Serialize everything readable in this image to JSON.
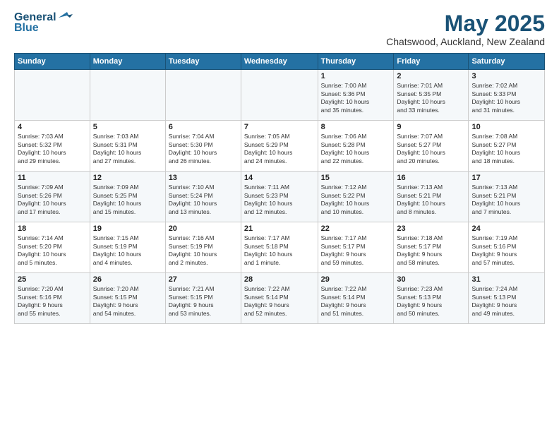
{
  "header": {
    "logo_line1": "General",
    "logo_line2": "Blue",
    "month": "May 2025",
    "location": "Chatswood, Auckland, New Zealand"
  },
  "days_of_week": [
    "Sunday",
    "Monday",
    "Tuesday",
    "Wednesday",
    "Thursday",
    "Friday",
    "Saturday"
  ],
  "weeks": [
    [
      {
        "day": "",
        "info": ""
      },
      {
        "day": "",
        "info": ""
      },
      {
        "day": "",
        "info": ""
      },
      {
        "day": "",
        "info": ""
      },
      {
        "day": "1",
        "info": "Sunrise: 7:00 AM\nSunset: 5:36 PM\nDaylight: 10 hours\nand 35 minutes."
      },
      {
        "day": "2",
        "info": "Sunrise: 7:01 AM\nSunset: 5:35 PM\nDaylight: 10 hours\nand 33 minutes."
      },
      {
        "day": "3",
        "info": "Sunrise: 7:02 AM\nSunset: 5:33 PM\nDaylight: 10 hours\nand 31 minutes."
      }
    ],
    [
      {
        "day": "4",
        "info": "Sunrise: 7:03 AM\nSunset: 5:32 PM\nDaylight: 10 hours\nand 29 minutes."
      },
      {
        "day": "5",
        "info": "Sunrise: 7:03 AM\nSunset: 5:31 PM\nDaylight: 10 hours\nand 27 minutes."
      },
      {
        "day": "6",
        "info": "Sunrise: 7:04 AM\nSunset: 5:30 PM\nDaylight: 10 hours\nand 26 minutes."
      },
      {
        "day": "7",
        "info": "Sunrise: 7:05 AM\nSunset: 5:29 PM\nDaylight: 10 hours\nand 24 minutes."
      },
      {
        "day": "8",
        "info": "Sunrise: 7:06 AM\nSunset: 5:28 PM\nDaylight: 10 hours\nand 22 minutes."
      },
      {
        "day": "9",
        "info": "Sunrise: 7:07 AM\nSunset: 5:27 PM\nDaylight: 10 hours\nand 20 minutes."
      },
      {
        "day": "10",
        "info": "Sunrise: 7:08 AM\nSunset: 5:27 PM\nDaylight: 10 hours\nand 18 minutes."
      }
    ],
    [
      {
        "day": "11",
        "info": "Sunrise: 7:09 AM\nSunset: 5:26 PM\nDaylight: 10 hours\nand 17 minutes."
      },
      {
        "day": "12",
        "info": "Sunrise: 7:09 AM\nSunset: 5:25 PM\nDaylight: 10 hours\nand 15 minutes."
      },
      {
        "day": "13",
        "info": "Sunrise: 7:10 AM\nSunset: 5:24 PM\nDaylight: 10 hours\nand 13 minutes."
      },
      {
        "day": "14",
        "info": "Sunrise: 7:11 AM\nSunset: 5:23 PM\nDaylight: 10 hours\nand 12 minutes."
      },
      {
        "day": "15",
        "info": "Sunrise: 7:12 AM\nSunset: 5:22 PM\nDaylight: 10 hours\nand 10 minutes."
      },
      {
        "day": "16",
        "info": "Sunrise: 7:13 AM\nSunset: 5:21 PM\nDaylight: 10 hours\nand 8 minutes."
      },
      {
        "day": "17",
        "info": "Sunrise: 7:13 AM\nSunset: 5:21 PM\nDaylight: 10 hours\nand 7 minutes."
      }
    ],
    [
      {
        "day": "18",
        "info": "Sunrise: 7:14 AM\nSunset: 5:20 PM\nDaylight: 10 hours\nand 5 minutes."
      },
      {
        "day": "19",
        "info": "Sunrise: 7:15 AM\nSunset: 5:19 PM\nDaylight: 10 hours\nand 4 minutes."
      },
      {
        "day": "20",
        "info": "Sunrise: 7:16 AM\nSunset: 5:19 PM\nDaylight: 10 hours\nand 2 minutes."
      },
      {
        "day": "21",
        "info": "Sunrise: 7:17 AM\nSunset: 5:18 PM\nDaylight: 10 hours\nand 1 minute."
      },
      {
        "day": "22",
        "info": "Sunrise: 7:17 AM\nSunset: 5:17 PM\nDaylight: 9 hours\nand 59 minutes."
      },
      {
        "day": "23",
        "info": "Sunrise: 7:18 AM\nSunset: 5:17 PM\nDaylight: 9 hours\nand 58 minutes."
      },
      {
        "day": "24",
        "info": "Sunrise: 7:19 AM\nSunset: 5:16 PM\nDaylight: 9 hours\nand 57 minutes."
      }
    ],
    [
      {
        "day": "25",
        "info": "Sunrise: 7:20 AM\nSunset: 5:16 PM\nDaylight: 9 hours\nand 55 minutes."
      },
      {
        "day": "26",
        "info": "Sunrise: 7:20 AM\nSunset: 5:15 PM\nDaylight: 9 hours\nand 54 minutes."
      },
      {
        "day": "27",
        "info": "Sunrise: 7:21 AM\nSunset: 5:15 PM\nDaylight: 9 hours\nand 53 minutes."
      },
      {
        "day": "28",
        "info": "Sunrise: 7:22 AM\nSunset: 5:14 PM\nDaylight: 9 hours\nand 52 minutes."
      },
      {
        "day": "29",
        "info": "Sunrise: 7:22 AM\nSunset: 5:14 PM\nDaylight: 9 hours\nand 51 minutes."
      },
      {
        "day": "30",
        "info": "Sunrise: 7:23 AM\nSunset: 5:13 PM\nDaylight: 9 hours\nand 50 minutes."
      },
      {
        "day": "31",
        "info": "Sunrise: 7:24 AM\nSunset: 5:13 PM\nDaylight: 9 hours\nand 49 minutes."
      }
    ]
  ]
}
